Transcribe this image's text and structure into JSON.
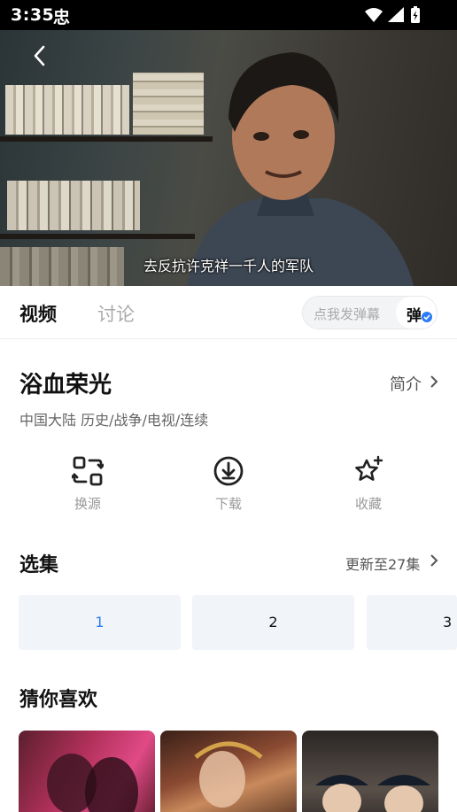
{
  "status_bar": {
    "time": "3:35",
    "app_glyph": "忠"
  },
  "player": {
    "subtitle": "去反抗许克祥一千人的军队"
  },
  "tabs": [
    {
      "label": "视频"
    },
    {
      "label": "讨论"
    }
  ],
  "danmu": {
    "placeholder": "点我发弹幕",
    "toggle_label": "弹"
  },
  "show": {
    "title": "浴血荣光",
    "intro_label": "简介",
    "meta": "中国大陆  历史/战争/电视/连续"
  },
  "actions": [
    {
      "label": "换源",
      "icon": "switch-source-icon"
    },
    {
      "label": "下载",
      "icon": "download-icon"
    },
    {
      "label": "收藏",
      "icon": "star-add-icon"
    }
  ],
  "episodes": {
    "title": "选集",
    "update_label": "更新至27集",
    "items": [
      "1",
      "2",
      "3"
    ],
    "selected": "1"
  },
  "recommend": {
    "title": "猜你喜欢"
  },
  "colors": {
    "accent": "#2d7cf6",
    "tile_bg": "#f1f4f8"
  }
}
